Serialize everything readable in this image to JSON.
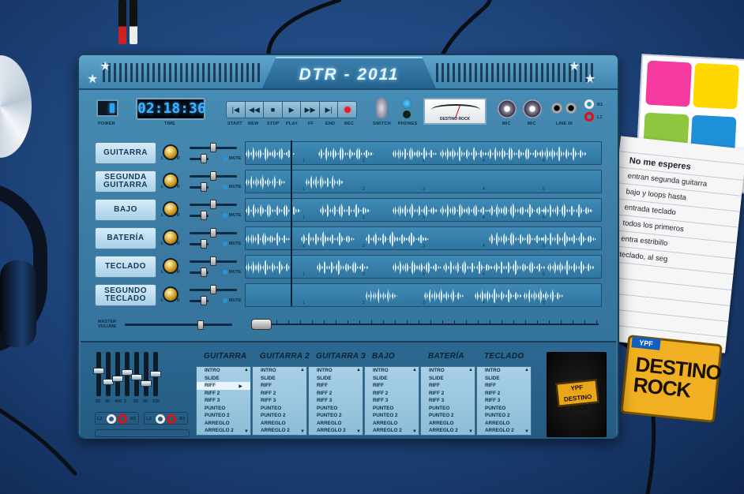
{
  "app": {
    "title": "DTR - 2011"
  },
  "transport": {
    "power_label": "POWER",
    "time_label": "TIME",
    "time_value": "02:18:36",
    "buttons": [
      {
        "label": "START",
        "icon": "|◀"
      },
      {
        "label": "REW",
        "icon": "◀◀"
      },
      {
        "label": "STOP",
        "icon": "■"
      },
      {
        "label": "PLAY",
        "icon": "▶"
      },
      {
        "label": "FF",
        "icon": "▶▶"
      },
      {
        "label": "END",
        "icon": "▶|"
      },
      {
        "label": "REC",
        "icon": ""
      }
    ],
    "switch_label": "SWITCH",
    "phones_label": "PHONES",
    "vu_label": "DESTINO ROCK",
    "mic1_label": "MIC",
    "mic2_label": "MIC",
    "line_in_label": "LINE IN",
    "r1_label": "R1",
    "l1_label": "L1"
  },
  "tracks": [
    {
      "name": "GUITARRA",
      "mute_label": "MUTE"
    },
    {
      "name": "SEGUNDA GUITARRA",
      "mute_label": "MUTE"
    },
    {
      "name": "BAJO",
      "mute_label": "MUTE"
    },
    {
      "name": "BATERÍA",
      "mute_label": "MUTE"
    },
    {
      "name": "TECLADO",
      "mute_label": "MUTE"
    },
    {
      "name": "SEGUNDO TECLADO",
      "mute_label": "MUTE"
    }
  ],
  "track_knob": {
    "l": "L",
    "r": "R"
  },
  "markers": [
    "1",
    "2",
    "3",
    "4",
    "5",
    "6"
  ],
  "master": {
    "label_line1": "MASTER",
    "label_line2": "VOLUME"
  },
  "eq": {
    "bands": [
      "20",
      "40",
      "400",
      "2",
      "20",
      "60",
      "120"
    ],
    "l2": "L2",
    "r2": "R2",
    "l3": "L3",
    "r3": "R3"
  },
  "columns": [
    {
      "title": "GUITARRA",
      "items": [
        "INTRO",
        "SLIDE",
        "RIFF",
        "RIFF 2",
        "RIFF 3",
        "PUNTEO",
        "PUNTEO 2",
        "ARREGLO",
        "ARREGLO 2"
      ],
      "selected": 2
    },
    {
      "title": "GUITARRA 2",
      "items": [
        "INTRO",
        "SLIDE",
        "RIFF",
        "RIFF 2",
        "RIFF 3",
        "PUNTEO",
        "PUNTEO 2",
        "ARREGLO",
        "ARREGLO 2"
      ],
      "selected": -1
    },
    {
      "title": "GUITARRA 3",
      "items": [
        "INTRO",
        "SLIDE",
        "RIFF",
        "RIFF 2",
        "RIFF 3",
        "PUNTEO",
        "PUNTEO 2",
        "ARREGLO",
        "ARREGLO 2"
      ],
      "selected": -1
    },
    {
      "title": "BAJO",
      "items": [
        "INTRO",
        "SLIDE",
        "RIFF",
        "RIFF 2",
        "RIFF 3",
        "PUNTEO",
        "PUNTEO 2",
        "ARREGLO",
        "ARREGLO 2"
      ],
      "selected": -1
    },
    {
      "title": "BATERÍA",
      "items": [
        "INTRO",
        "SLIDE",
        "RIFF",
        "RIFF 2",
        "RIFF 3",
        "PUNTEO",
        "PUNTEO 2",
        "ARREGLO",
        "ARREGLO 2"
      ],
      "selected": -1
    },
    {
      "title": "TECLADO",
      "items": [
        "INTRO",
        "SLIDE",
        "RIFF",
        "RIFF 2",
        "RIFF 3",
        "PUNTEO",
        "PUNTEO 2",
        "ARREGLO",
        "ARREGLO 2"
      ],
      "selected": -1
    }
  ],
  "logo": {
    "brand": "YPF",
    "text": "DESTINO ROCK",
    "year": "2011"
  },
  "notes": {
    "title": "No me esperes",
    "lines": [
      "entran segunda guitarra",
      "bajo y loops hasta",
      "",
      "entrada teclado",
      "todos los primeros",
      "",
      "entra estribillo",
      "",
      "",
      "teclado, al seg"
    ]
  },
  "sticker": {
    "brand": "YPF",
    "line1": "DESTINO",
    "line2": "ROCK"
  },
  "colors": {
    "accent": "#3fb2ff",
    "panel": "#3a7aa2",
    "rec": "#e0202a",
    "knob": "#d09a1a"
  }
}
